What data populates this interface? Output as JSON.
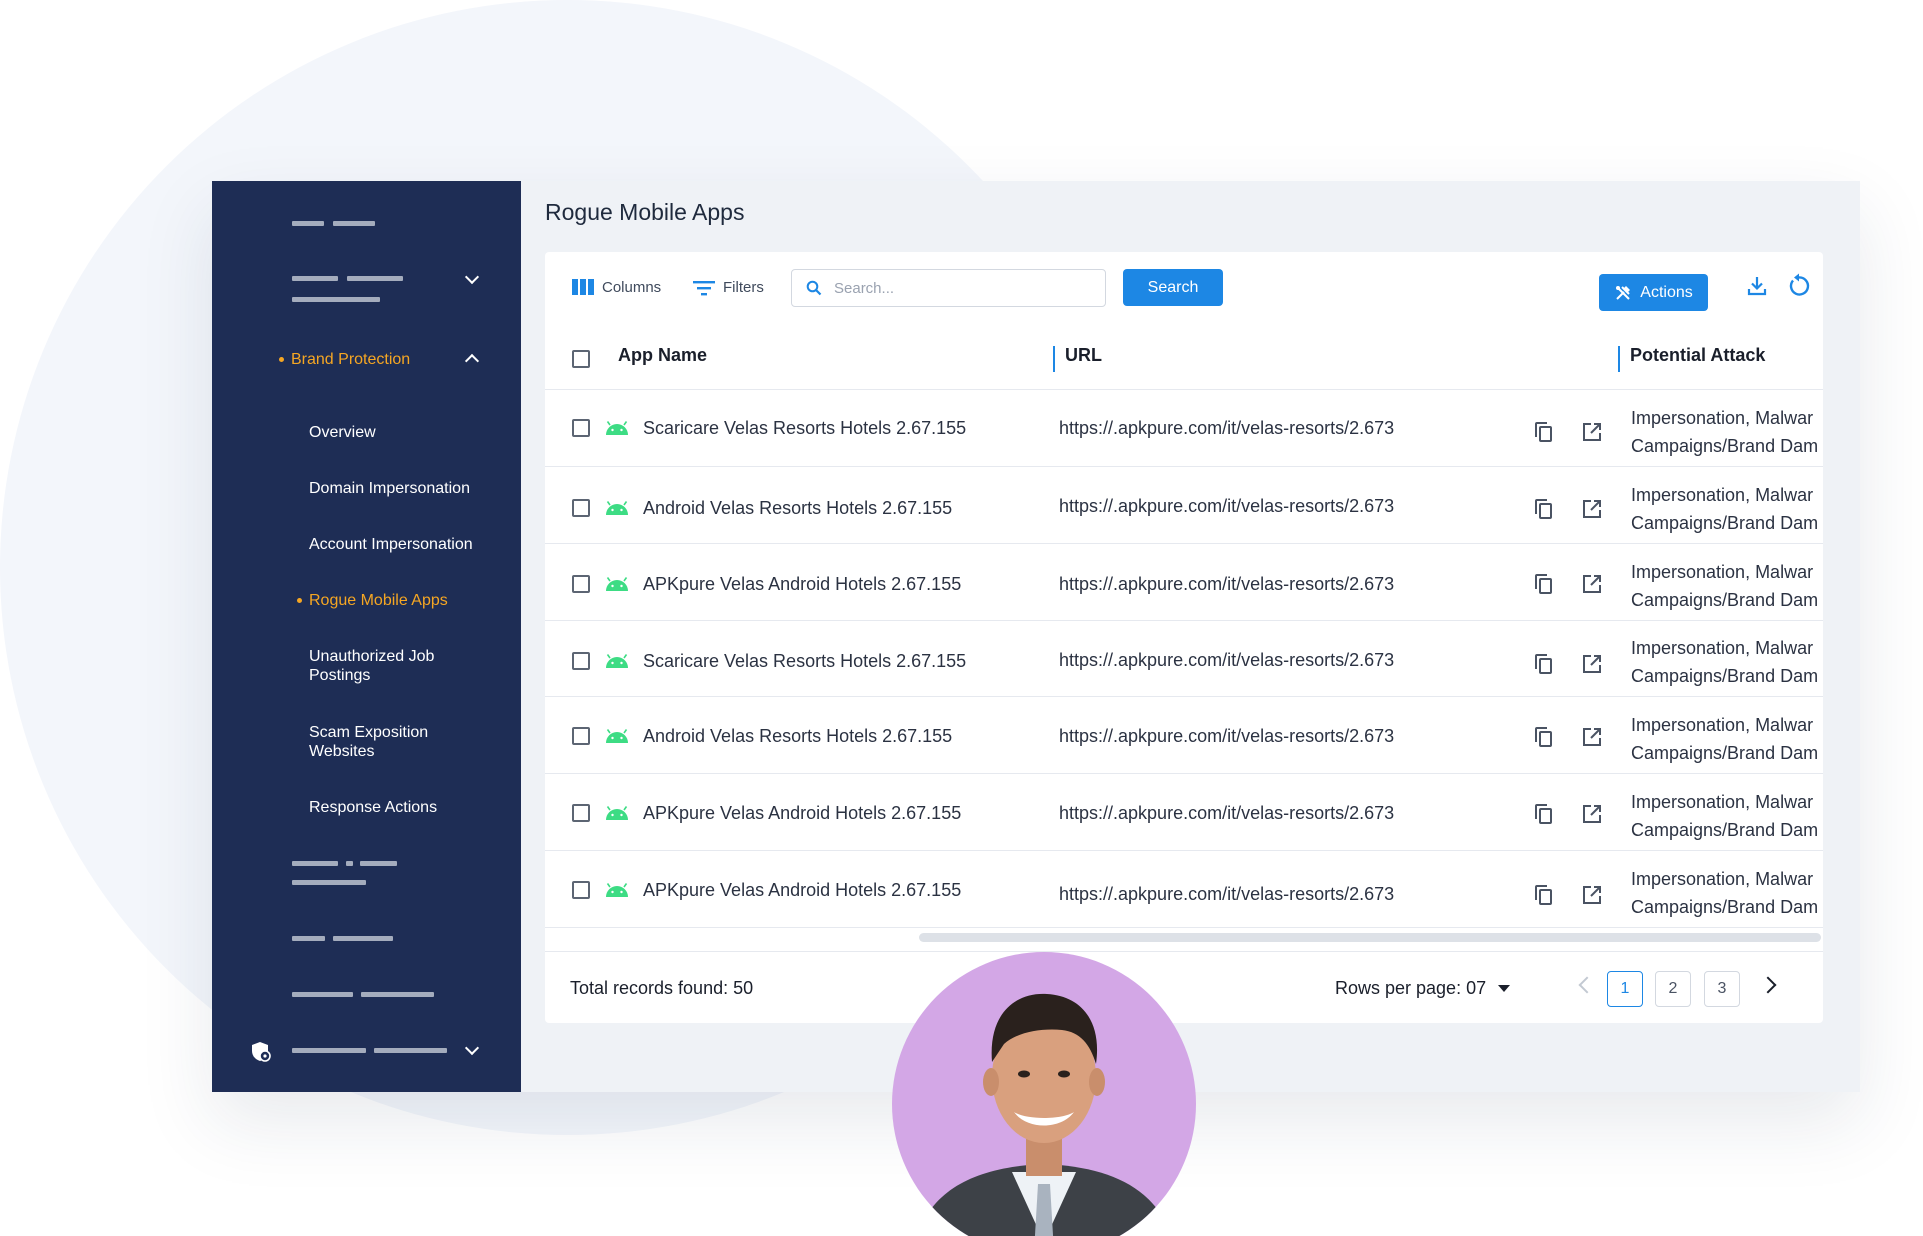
{
  "sidebar": {
    "section_label": "Brand Protection",
    "items": [
      {
        "label": "Overview"
      },
      {
        "label": "Domain Impersonation"
      },
      {
        "label": "Account Impersonation"
      },
      {
        "label": "Rogue Mobile Apps"
      },
      {
        "label": "Unauthorized Job Postings"
      },
      {
        "label": "Scam Exposition Websites"
      },
      {
        "label": "Response Actions"
      }
    ],
    "active_item": "Rogue Mobile Apps"
  },
  "page": {
    "title": "Rogue Mobile Apps"
  },
  "toolbar": {
    "columns_label": "Columns",
    "filters_label": "Filters",
    "search_placeholder": "Search...",
    "search_button": "Search",
    "actions_button": "Actions",
    "download_icon": "download-icon",
    "refresh_icon": "refresh-icon"
  },
  "table": {
    "headers": {
      "app_name": "App Name",
      "url": "URL",
      "potential_attack": "Potential Attack"
    },
    "rows": [
      {
        "app_name": "Scaricare Velas Resorts Hotels 2.67.155",
        "url": "https://.apkpure.com/it/velas-resorts/2.673",
        "attack_line1": "Impersonation, Malwar",
        "attack_line2": "Campaigns/Brand Dam"
      },
      {
        "app_name": "Android Velas Resorts Hotels 2.67.155",
        "url": "https://.apkpure.com/it/velas-resorts/2.673",
        "attack_line1": "Impersonation, Malwar",
        "attack_line2": "Campaigns/Brand Dam"
      },
      {
        "app_name": "APKpure Velas Android Hotels 2.67.155",
        "url": "https://.apkpure.com/it/velas-resorts/2.673",
        "attack_line1": "Impersonation, Malwar",
        "attack_line2": "Campaigns/Brand Dam"
      },
      {
        "app_name": "Scaricare Velas Resorts Hotels 2.67.155",
        "url": "https://.apkpure.com/it/velas-resorts/2.673",
        "attack_line1": "Impersonation, Malwar",
        "attack_line2": "Campaigns/Brand Dam"
      },
      {
        "app_name": "Android Velas Resorts Hotels 2.67.155",
        "url": "https://.apkpure.com/it/velas-resorts/2.673",
        "attack_line1": "Impersonation, Malwar",
        "attack_line2": "Campaigns/Brand Dam"
      },
      {
        "app_name": "APKpure Velas Android Hotels 2.67.155",
        "url": "https://.apkpure.com/it/velas-resorts/2.673",
        "attack_line1": "Impersonation, Malwar",
        "attack_line2": "Campaigns/Brand Dam"
      },
      {
        "app_name": "APKpure Velas Android Hotels 2.67.155",
        "url": "https://.apkpure.com/it/velas-resorts/2.673",
        "attack_line1": "Impersonation, Malwar",
        "attack_line2": "Campaigns/Brand Dam"
      }
    ]
  },
  "footer": {
    "total_records": "Total records found: 50",
    "rows_per_page": "Rows per page: 07",
    "pages": [
      "1",
      "2",
      "3"
    ],
    "current_page": "1"
  },
  "colors": {
    "sidebar_bg": "#1e2d55",
    "accent": "#1d87e4",
    "active_nav": "#f5a623",
    "android_green": "#3ddc84",
    "avatar_bg": "#d3a7e6"
  }
}
